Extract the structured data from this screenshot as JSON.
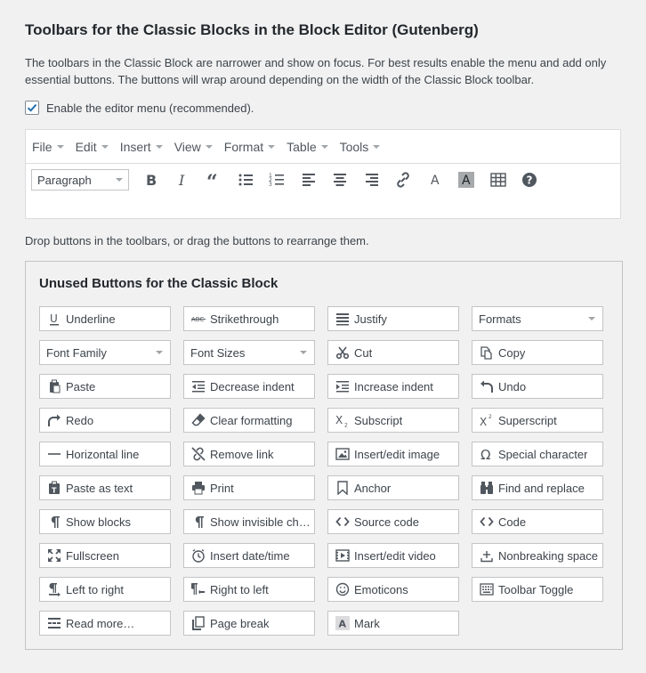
{
  "page": {
    "title": "Toolbars for the Classic Blocks in the Block Editor (Gutenberg)",
    "description_line1": "The toolbars in the Classic Block are narrower and show on focus. For best results enable the menu and add only",
    "description_line2": "essential buttons. The buttons will wrap around depending on the width of the Classic Block toolbar.",
    "checkbox_label": "Enable the editor menu (recommended).",
    "checkbox_checked": true,
    "drop_text": "Drop buttons in the toolbars, or drag the buttons to rearrange them."
  },
  "editor": {
    "menus": [
      "File",
      "Edit",
      "Insert",
      "View",
      "Format",
      "Table",
      "Tools"
    ],
    "paragraph_select": "Paragraph",
    "toolbar_icons": [
      "bold-icon",
      "italic-icon",
      "blockquote-icon",
      "bullet-list-icon",
      "numbered-list-icon",
      "align-left-icon",
      "align-center-icon",
      "align-right-icon",
      "link-icon",
      "text-color-icon",
      "background-color-icon",
      "table-icon",
      "help-icon"
    ]
  },
  "unused": {
    "title": "Unused Buttons for the Classic Block",
    "buttons": [
      {
        "label": "Underline",
        "icon": "underline-icon"
      },
      {
        "label": "Strikethrough",
        "icon": "strikethrough-icon"
      },
      {
        "label": "Justify",
        "icon": "justify-icon"
      },
      {
        "label": "Formats",
        "type": "select"
      },
      {
        "label": "Font Family",
        "type": "select"
      },
      {
        "label": "Font Sizes",
        "type": "select"
      },
      {
        "label": "Cut",
        "icon": "cut-icon"
      },
      {
        "label": "Copy",
        "icon": "copy-icon"
      },
      {
        "label": "Paste",
        "icon": "paste-icon"
      },
      {
        "label": "Decrease indent",
        "icon": "outdent-icon"
      },
      {
        "label": "Increase indent",
        "icon": "indent-icon"
      },
      {
        "label": "Undo",
        "icon": "undo-icon"
      },
      {
        "label": "Redo",
        "icon": "redo-icon"
      },
      {
        "label": "Clear formatting",
        "icon": "eraser-icon"
      },
      {
        "label": "Subscript",
        "icon": "subscript-icon"
      },
      {
        "label": "Superscript",
        "icon": "superscript-icon"
      },
      {
        "label": "Horizontal line",
        "icon": "hr-icon"
      },
      {
        "label": "Remove link",
        "icon": "unlink-icon"
      },
      {
        "label": "Insert/edit image",
        "icon": "image-icon"
      },
      {
        "label": "Special character",
        "icon": "omega-icon"
      },
      {
        "label": "Paste as text",
        "icon": "paste-text-icon"
      },
      {
        "label": "Print",
        "icon": "print-icon"
      },
      {
        "label": "Anchor",
        "icon": "anchor-icon"
      },
      {
        "label": "Find and replace",
        "icon": "binoculars-icon"
      },
      {
        "label": "Show blocks",
        "icon": "pilcrow-icon"
      },
      {
        "label": "Show invisible chara…",
        "icon": "pilcrow-icon"
      },
      {
        "label": "Source code",
        "icon": "code-icon"
      },
      {
        "label": "Code",
        "icon": "code-icon"
      },
      {
        "label": "Fullscreen",
        "icon": "fullscreen-icon"
      },
      {
        "label": "Insert date/time",
        "icon": "clock-icon"
      },
      {
        "label": "Insert/edit video",
        "icon": "video-icon"
      },
      {
        "label": "Nonbreaking space",
        "icon": "nbsp-icon"
      },
      {
        "label": "Left to right",
        "icon": "ltr-icon"
      },
      {
        "label": "Right to left",
        "icon": "rtl-icon"
      },
      {
        "label": "Emoticons",
        "icon": "smiley-icon"
      },
      {
        "label": "Toolbar Toggle",
        "icon": "keyboard-icon"
      },
      {
        "label": "Read more…",
        "icon": "read-more-icon"
      },
      {
        "label": "Page break",
        "icon": "page-break-icon"
      },
      {
        "label": "Mark",
        "icon": "mark-icon"
      }
    ]
  },
  "colors": {
    "background": "#f1f1f1",
    "accent": "#2271b1",
    "border": "#c3c4c7",
    "text": "#3c434a"
  }
}
